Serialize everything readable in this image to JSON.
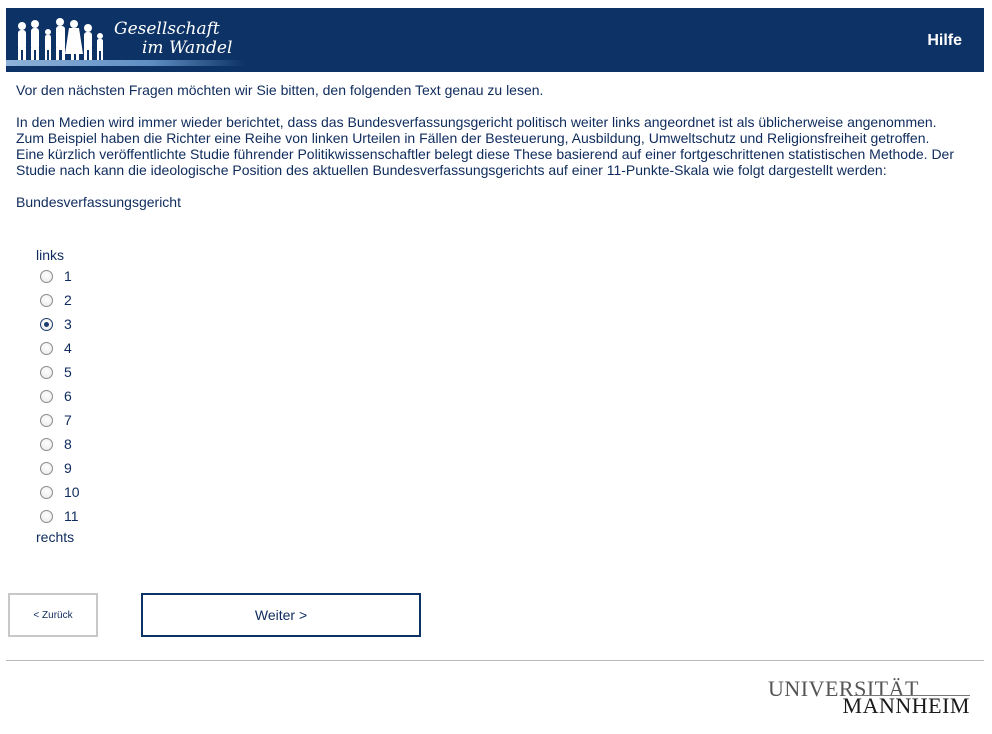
{
  "header": {
    "logo_line1": "Gesellschaft",
    "logo_line2": "im Wandel",
    "help_label": "Hilfe",
    "background_color": "#0d3265"
  },
  "content": {
    "intro": "Vor den nächsten Fragen möchten wir Sie bitten, den folgenden Text genau zu lesen.",
    "body": "In den Medien wird immer wieder berichtet, dass das Bundesverfassungsgericht politisch weiter links angeordnet ist als üblicherweise angenommen. Zum Beispiel haben die Richter eine Reihe von linken Urteilen in Fällen der Besteuerung, Ausbildung, Umweltschutz und Religionsfreiheit getroffen. Eine kürzlich veröffentlichte Studie führender Politikwissenschaftler belegt diese These basierend auf einer fortgeschrittenen statistischen Methode. Der Studie nach kann die ideologische Position des aktuellen Bundesverfassungsgerichts auf einer 11-Punkte-Skala wie folgt dargestellt werden:",
    "question_label": "Bundesverfassungsgericht"
  },
  "scale": {
    "top_label": "links",
    "bottom_label": "rechts",
    "options": [
      "1",
      "2",
      "3",
      "4",
      "5",
      "6",
      "7",
      "8",
      "9",
      "10",
      "11"
    ],
    "selected": "3"
  },
  "navigation": {
    "back_label": "< Zurück",
    "next_label": "Weiter >"
  },
  "footer": {
    "university_line1": "UNIVERSITÄT",
    "university_line2": "MANNHEIM"
  }
}
